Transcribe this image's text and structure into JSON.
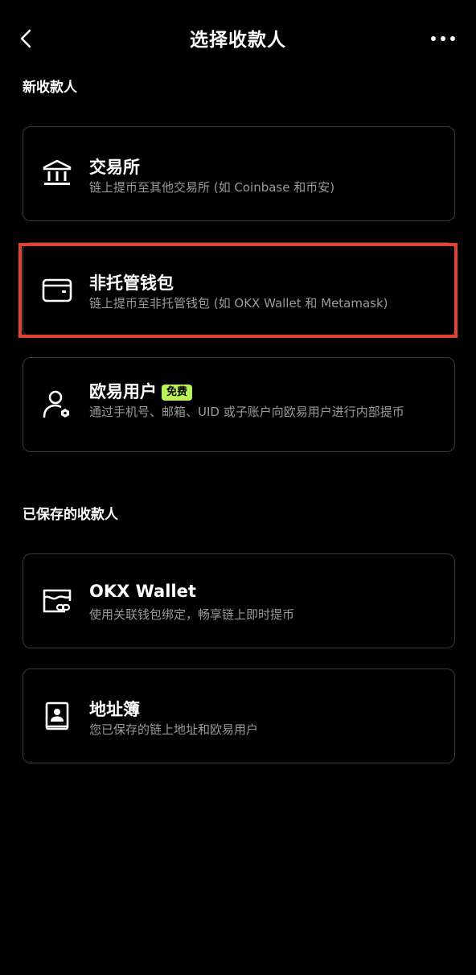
{
  "header": {
    "title": "选择收款人",
    "back_icon": "chevron-left-icon",
    "more_icon": "more-horizontal-icon"
  },
  "sections": {
    "new_label": "新收款人",
    "saved_label": "已保存的收款人"
  },
  "new_recipients": [
    {
      "icon": "bank-icon",
      "title": "交易所",
      "desc": "链上提币至其他交易所 (如 Coinbase 和币安)"
    },
    {
      "icon": "wallet-icon",
      "title": "非托管钱包",
      "desc": "链上提币至非托管钱包 (如 OKX Wallet 和 Metamask)"
    },
    {
      "icon": "user-icon",
      "title": "欧易用户",
      "badge": "免费",
      "desc": "通过手机号、邮箱、UID 或子账户向欧易用户进行内部提币"
    }
  ],
  "saved_recipients": [
    {
      "icon": "linked-wallet-icon",
      "title": "OKX Wallet",
      "desc": "使用关联钱包绑定，畅享链上即时提币"
    },
    {
      "icon": "address-book-icon",
      "title": "地址簿",
      "desc": "您已保存的链上地址和欧易用户"
    }
  ],
  "colors": {
    "background": "#000000",
    "card_border": "#3a3a3a",
    "secondary_text": "#9a9a9a",
    "badge_bg": "#b9f355",
    "highlight": "#e5432e"
  }
}
